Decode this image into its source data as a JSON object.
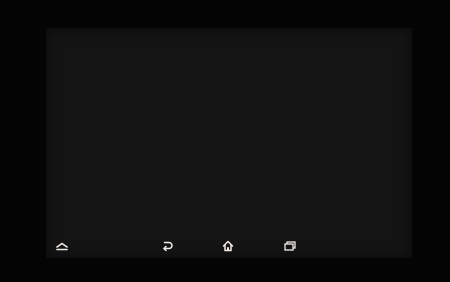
{
  "navbar": {
    "icon_color": "#f2ece6",
    "buttons": [
      {
        "id": "hide",
        "icon": "chevron-up-icon"
      },
      {
        "id": "back",
        "icon": "back-arrow-icon"
      },
      {
        "id": "home",
        "icon": "home-icon"
      },
      {
        "id": "recent",
        "icon": "recent-apps-icon"
      }
    ]
  }
}
